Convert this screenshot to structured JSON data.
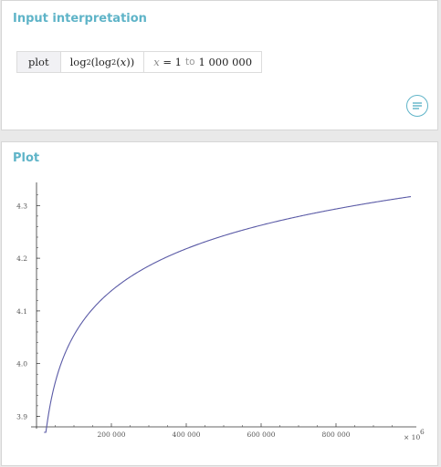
{
  "input_pod": {
    "title": "Input interpretation",
    "command": "plot",
    "expression": {
      "outer_fn": "log",
      "outer_base": "2",
      "inner_fn": "log",
      "inner_base": "2",
      "variable": "x"
    },
    "range": {
      "variable": "x",
      "equals": "= 1",
      "to": "to",
      "end": "1 000 000"
    },
    "menu_icon": "lines-menu-icon"
  },
  "plot_pod": {
    "title": "Plot",
    "line_color": "#5a5aa6",
    "axis_color": "#333333",
    "x_multiplier_label": "× 10",
    "x_multiplier_exp": "6"
  },
  "chart_data": {
    "type": "line",
    "function": "log2(log2(x))",
    "x_range": [
      1,
      1000000
    ],
    "xlim": [
      0,
      1000000
    ],
    "ylim": [
      3.88,
      4.33
    ],
    "x_ticks": [
      200000,
      400000,
      600000,
      800000
    ],
    "x_tick_labels": [
      "200 000",
      "400 000",
      "600 000",
      "800 000"
    ],
    "y_ticks": [
      3.9,
      4.0,
      4.1,
      4.2,
      4.3
    ],
    "y_tick_labels": [
      "3.9",
      "4.0",
      "4.1",
      "4.2",
      "4.3"
    ],
    "series": [
      {
        "x": [
          25000,
          50000,
          100000,
          200000,
          300000,
          400000,
          500000,
          600000,
          700000,
          800000,
          900000,
          1000000
        ],
        "y": [
          3.871,
          3.966,
          4.054,
          4.139,
          4.186,
          4.219,
          4.243,
          4.263,
          4.28,
          4.295,
          4.308,
          4.317
        ]
      }
    ]
  }
}
